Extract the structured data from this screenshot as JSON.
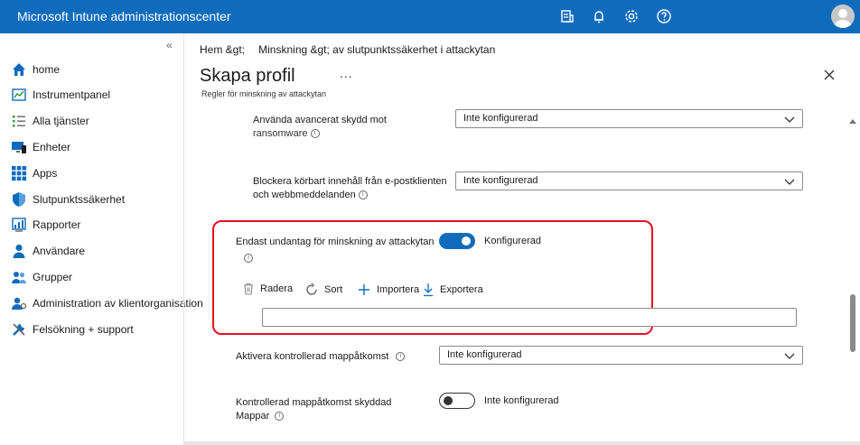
{
  "app": {
    "title": "Microsoft Intune administrationscenter"
  },
  "topbar_icons": [
    "portal-icon",
    "bell-icon",
    "gear-icon",
    "help-icon",
    "avatar"
  ],
  "sidebar": {
    "collapse": "«",
    "items": [
      {
        "label": "home",
        "icon": "home-icon"
      },
      {
        "label": "Instrumentpanel",
        "icon": "dashboard-icon"
      },
      {
        "label": "Alla tjänster",
        "icon": "list-icon"
      },
      {
        "label": "Enheter",
        "icon": "devices-icon"
      },
      {
        "label": "Apps",
        "icon": "apps-icon"
      },
      {
        "label": "Slutpunktssäkerhet",
        "icon": "shield-icon"
      },
      {
        "label": "Rapporter",
        "icon": "reports-icon"
      },
      {
        "label": "Användare",
        "icon": "user-icon"
      },
      {
        "label": "Grupper",
        "icon": "group-icon"
      },
      {
        "label": "Administration av klientorganisation",
        "icon": "tenant-icon"
      },
      {
        "label": "Felsökning + support",
        "icon": "wrench-icon"
      }
    ]
  },
  "breadcrumb": {
    "home": "Hem &gt;",
    "sep": "|",
    "current": "Minskning &gt; av slutpunktssäkerhet i attackytan"
  },
  "page": {
    "title": "Skapa profil",
    "more": "...",
    "subtitle": "Regler för minskning av attackytan"
  },
  "settings": {
    "ransomware": {
      "label_line1": "Använda avancerat skydd mot",
      "label_line2": "ransomware",
      "value": "Inte konfigurerad"
    },
    "email": {
      "label_line1": "Blockera körbart innehåll från e-postklienten",
      "label_line2": "och webbmeddelanden",
      "value": "Inte konfigurerad"
    },
    "exclusions": {
      "label": "Endast undantag för minskning av attackytan",
      "toggle_state": "on",
      "toggle_value": "Konfigurerad",
      "toolbar": {
        "delete": "Radera",
        "sort": "Sort",
        "import": "Importera",
        "export": "Exportera"
      },
      "input_value": ""
    },
    "cfa": {
      "label": "Aktivera kontrollerad mappåtkomst",
      "value": "Inte konfigurerad"
    },
    "cfa_folders": {
      "label_line1": "Kontrollerad mappåtkomst skyddad",
      "label_line2": "Mappar",
      "toggle_state": "off",
      "toggle_value": "Inte konfigurerad"
    }
  },
  "colors": {
    "accent": "#0f6cbd",
    "highlight": "#e81123"
  }
}
